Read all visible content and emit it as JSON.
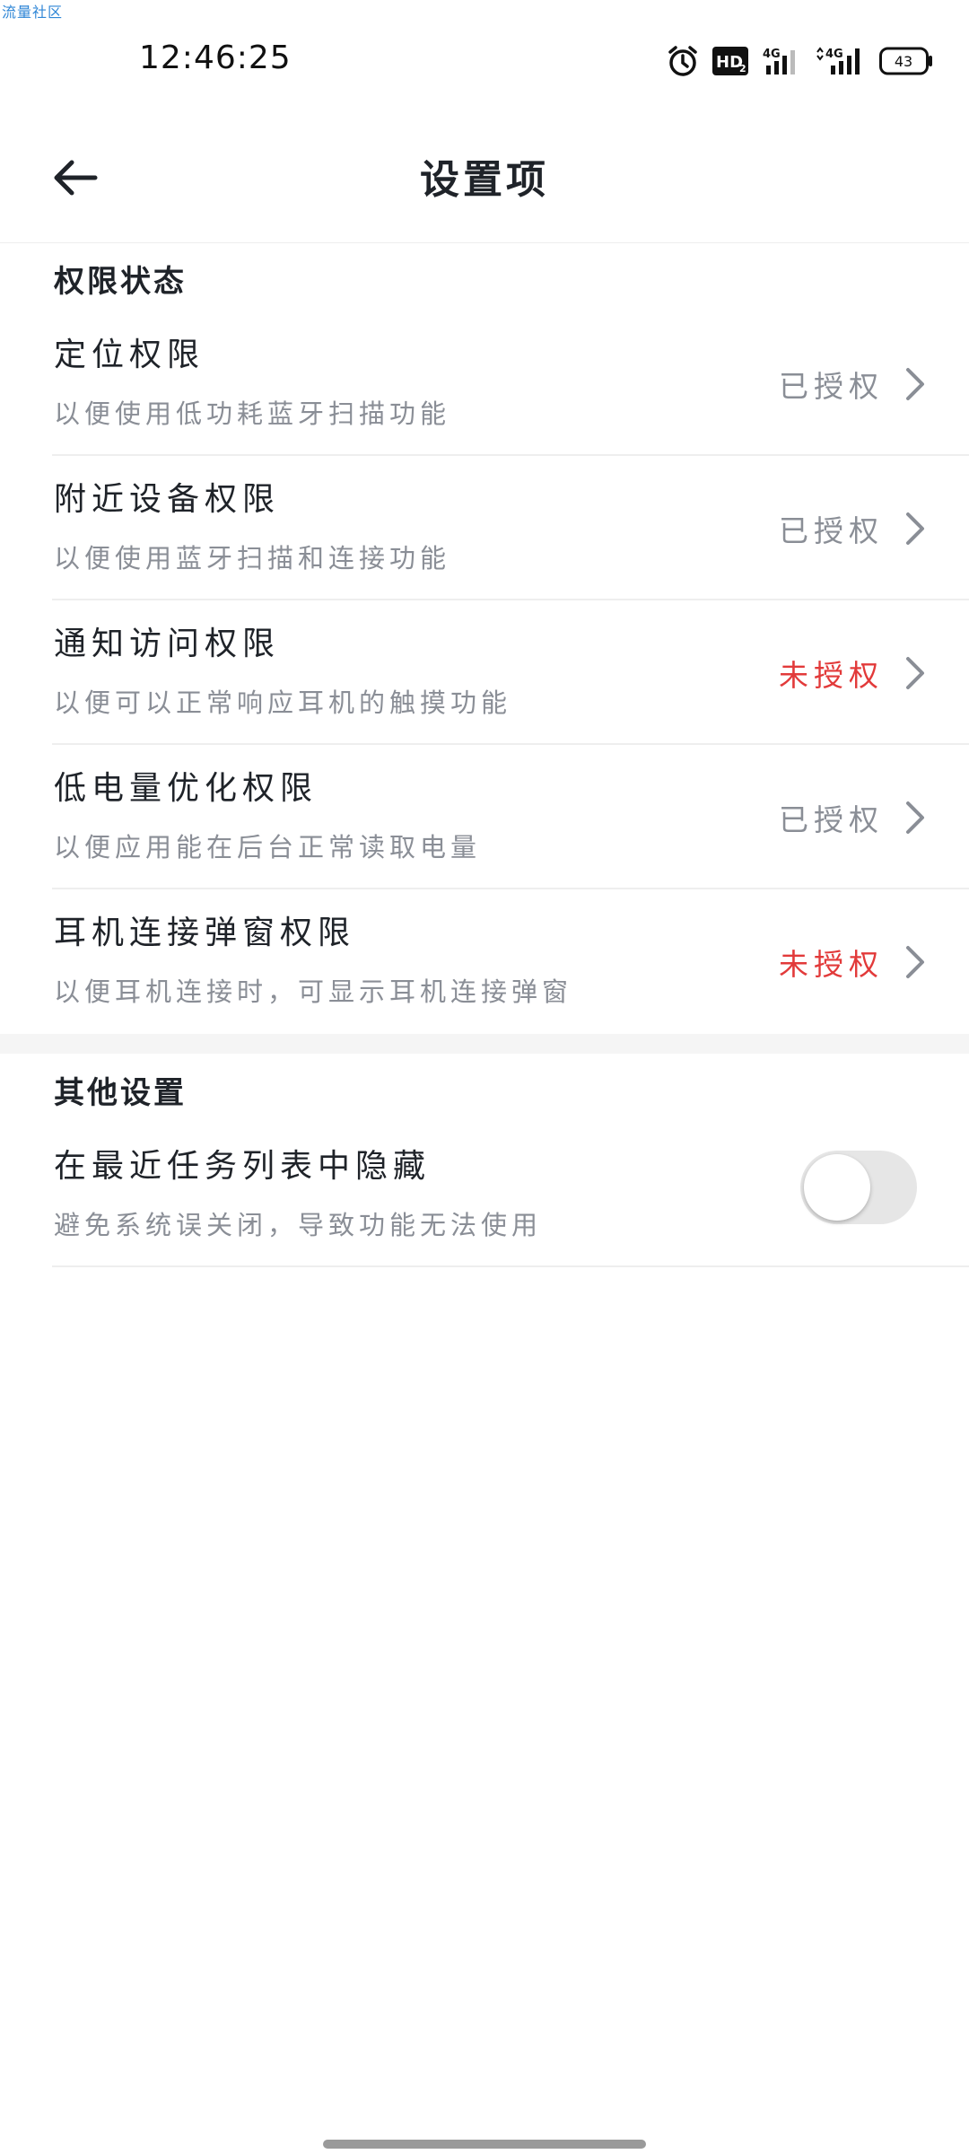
{
  "watermark": "流量社区",
  "status_bar": {
    "time": "12:46:25",
    "icons": [
      "alarm-icon",
      "hd-icon",
      "signal-4g-icon",
      "signal-4g-icon",
      "battery-icon"
    ],
    "hd_label": "HD",
    "hd_sub": "2",
    "net_label": "4G",
    "battery": "43"
  },
  "header": {
    "title": "设置项",
    "back_icon": "arrow-left-icon"
  },
  "sections": [
    {
      "title": "权限状态",
      "items": [
        {
          "title": "定位权限",
          "subtitle": "以便使用低功耗蓝牙扫描功能",
          "status": "已授权",
          "status_color": "#8a8e96"
        },
        {
          "title": "附近设备权限",
          "subtitle": "以便使用蓝牙扫描和连接功能",
          "status": "已授权",
          "status_color": "#8a8e96"
        },
        {
          "title": "通知访问权限",
          "subtitle": "以便可以正常响应耳机的触摸功能",
          "status": "未授权",
          "status_color": "#e23a3a"
        },
        {
          "title": "低电量优化权限",
          "subtitle": "以便应用能在后台正常读取电量",
          "status": "已授权",
          "status_color": "#8a8e96"
        },
        {
          "title": "耳机连接弹窗权限",
          "subtitle": "以便耳机连接时，可显示耳机连接弹窗",
          "status": "未授权",
          "status_color": "#e23a3a"
        }
      ]
    },
    {
      "title": "其他设置",
      "items": [
        {
          "title": "在最近任务列表中隐藏",
          "subtitle": "避免系统误关闭，导致功能无法使用",
          "toggle_on": false
        }
      ]
    }
  ],
  "colors": {
    "granted": "#8a8e96",
    "denied": "#e23a3a",
    "text": "#1f2329"
  }
}
